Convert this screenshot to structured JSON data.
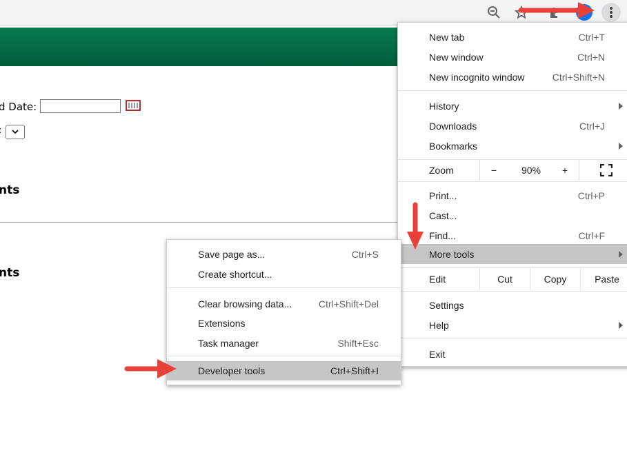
{
  "page": {
    "end_date_label": "d Date:",
    "paren_fragment": ")",
    "colon_fragment": ":",
    "heading_1": "nts",
    "heading_2": "nts"
  },
  "main_menu": {
    "new_tab": {
      "label": "New tab",
      "shortcut": "Ctrl+T"
    },
    "new_window": {
      "label": "New window",
      "shortcut": "Ctrl+N"
    },
    "new_incognito": {
      "label": "New incognito window",
      "shortcut": "Ctrl+Shift+N"
    },
    "history": {
      "label": "History"
    },
    "downloads": {
      "label": "Downloads",
      "shortcut": "Ctrl+J"
    },
    "bookmarks": {
      "label": "Bookmarks"
    },
    "zoom": {
      "label": "Zoom",
      "minus": "−",
      "value": "90%",
      "plus": "+"
    },
    "print": {
      "label": "Print...",
      "shortcut": "Ctrl+P"
    },
    "cast": {
      "label": "Cast..."
    },
    "find": {
      "label": "Find...",
      "shortcut": "Ctrl+F"
    },
    "more_tools": {
      "label": "More tools"
    },
    "edit": {
      "label": "Edit",
      "cut": "Cut",
      "copy": "Copy",
      "paste": "Paste"
    },
    "settings": {
      "label": "Settings"
    },
    "help": {
      "label": "Help"
    },
    "exit": {
      "label": "Exit"
    }
  },
  "sub_menu": {
    "save_page": {
      "label": "Save page as...",
      "shortcut": "Ctrl+S"
    },
    "create_shortcut": {
      "label": "Create shortcut..."
    },
    "clear_data": {
      "label": "Clear browsing data...",
      "shortcut": "Ctrl+Shift+Del"
    },
    "extensions": {
      "label": "Extensions"
    },
    "task_manager": {
      "label": "Task manager",
      "shortcut": "Shift+Esc"
    },
    "dev_tools": {
      "label": "Developer tools",
      "shortcut": "Ctrl+Shift+I"
    }
  },
  "icons": {
    "zoom": "zoom-out-icon",
    "star": "bookmark-star-icon",
    "extensions": "puzzle-icon",
    "menu": "kebab-menu-icon",
    "fullscreen": "fullscreen-icon",
    "calendar": "calendar-icon"
  },
  "colors": {
    "banner": "#006b44",
    "highlight": "#c6c6c6",
    "annotation_arrow": "#e8413a"
  }
}
